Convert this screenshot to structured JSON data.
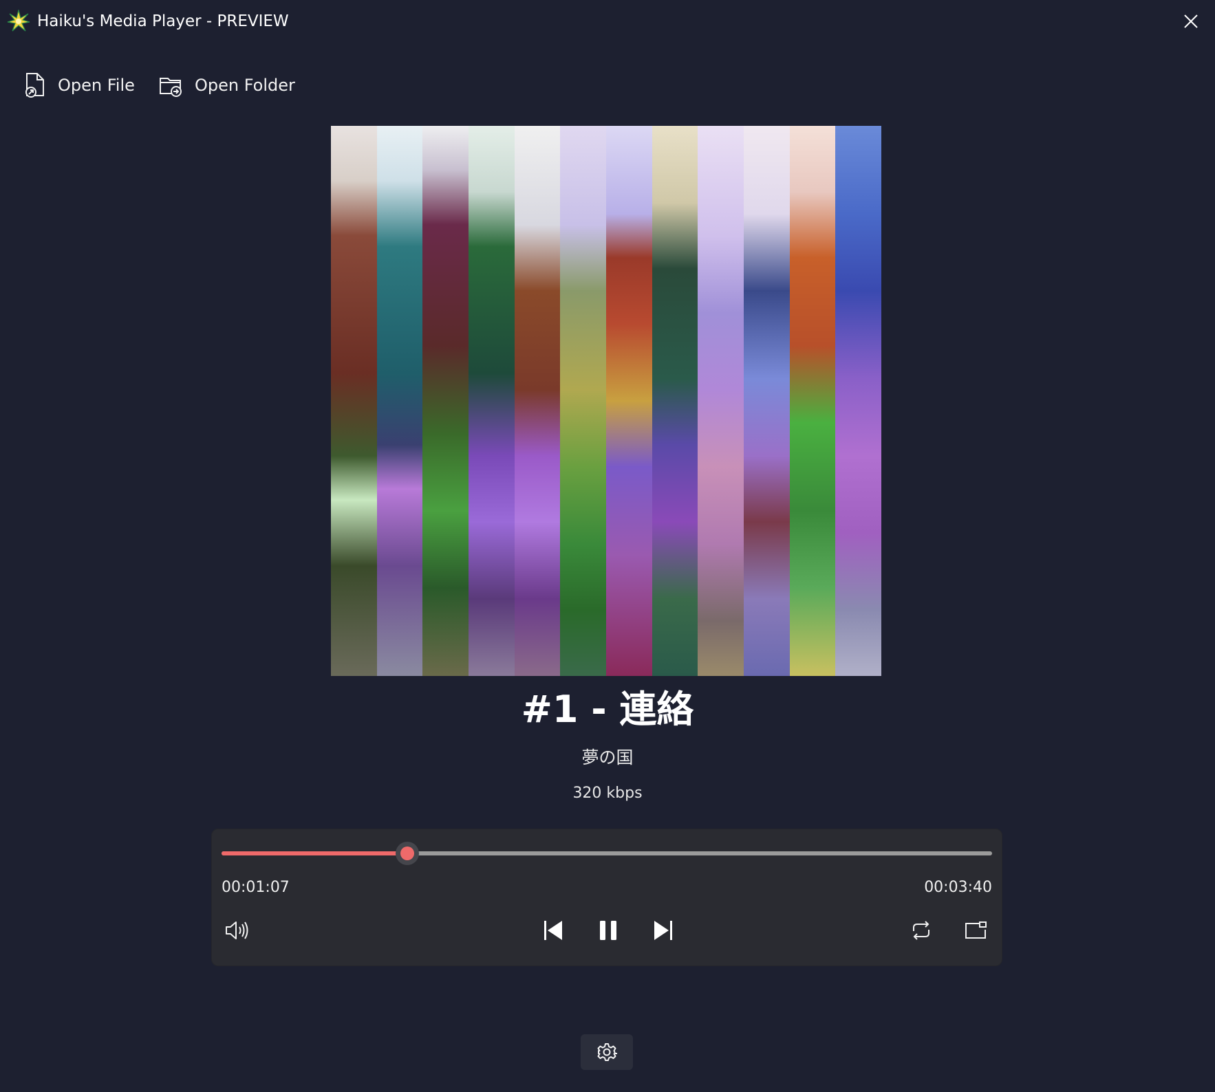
{
  "window": {
    "title": "Haiku's Media Player - PREVIEW",
    "app_icon": "sparkle-icon",
    "close_icon": "close-icon"
  },
  "toolbar": {
    "open_file_label": "Open File",
    "open_file_icon": "open-file-icon",
    "open_folder_label": "Open Folder",
    "open_folder_icon": "open-folder-icon"
  },
  "now_playing": {
    "title": "#1 - 連絡",
    "artist": "夢の国",
    "bitrate": "320 kbps",
    "album_art": "glitched colorful landscape"
  },
  "player": {
    "elapsed": "00:01:07",
    "duration": "00:03:40",
    "progress": 0.241,
    "accent_color": "#ef6a6a",
    "icons": [
      "volume-icon",
      "previous-icon",
      "pause-icon",
      "next-icon",
      "repeat-icon",
      "miniplayer-icon"
    ]
  },
  "footer": {
    "settings_icon": "gear-icon"
  }
}
